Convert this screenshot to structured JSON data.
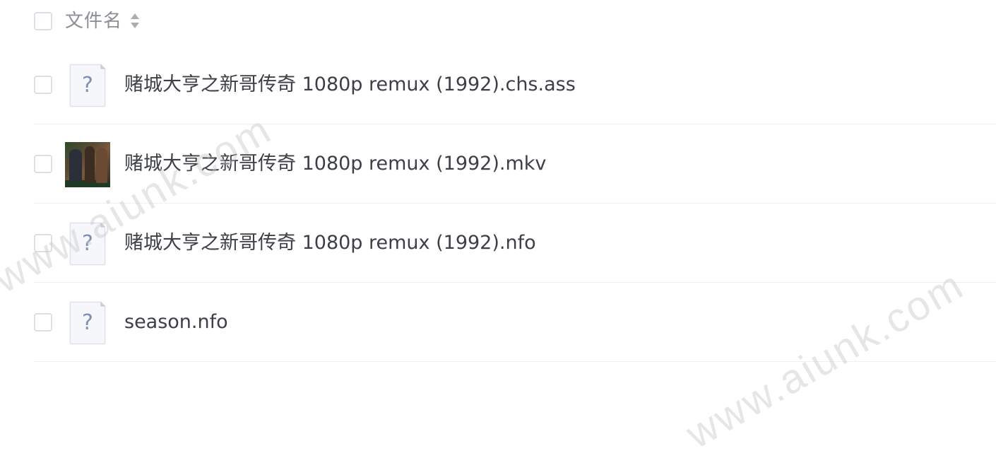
{
  "header": {
    "column_label": "文件名"
  },
  "files": [
    {
      "name": "赌城大亨之新哥传奇 1080p remux (1992).chs.ass",
      "icon": "unknown-file-icon"
    },
    {
      "name": "赌城大亨之新哥传奇 1080p remux (1992).mkv",
      "icon": "video-thumbnail"
    },
    {
      "name": "赌城大亨之新哥传奇 1080p remux (1992).nfo",
      "icon": "unknown-file-icon"
    },
    {
      "name": "season.nfo",
      "icon": "unknown-file-icon"
    }
  ],
  "watermarks": [
    "www.aiunk.com",
    "www.aiunk.com"
  ],
  "colors": {
    "text": "#3c3f45",
    "header_text": "#8c8f96",
    "checkbox_border": "#dcdfe6",
    "divider": "#eef0f3",
    "icon_fill": "#f5f7fb",
    "icon_glyph": "#7f8fb8"
  }
}
